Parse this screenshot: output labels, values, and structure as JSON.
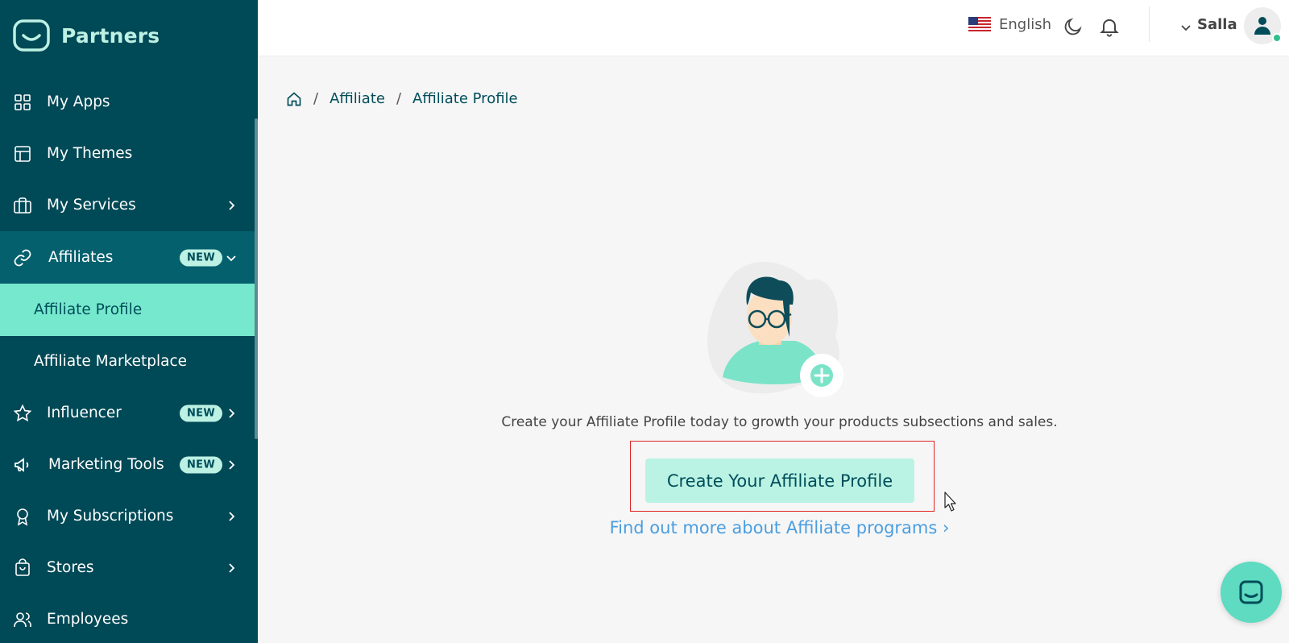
{
  "brand": {
    "name": "Partners"
  },
  "sidebar": {
    "items": [
      {
        "label": "My Apps",
        "icon": "grid-icon"
      },
      {
        "label": "My Themes",
        "icon": "layout-icon"
      },
      {
        "label": "My Services",
        "icon": "briefcase-icon",
        "has_chevron": true
      },
      {
        "label": "Affiliates",
        "icon": "link-icon",
        "badge": "NEW",
        "expanded": true
      },
      {
        "label": "Affiliate Profile",
        "sub": true,
        "selected": true
      },
      {
        "label": "Affiliate Marketplace",
        "sub": true
      },
      {
        "label": "Influencer",
        "icon": "star-icon",
        "badge": "NEW",
        "has_chevron": true
      },
      {
        "label": "Marketing Tools",
        "icon": "megaphone-icon",
        "badge": "NEW",
        "has_chevron": true
      },
      {
        "label": "My Subscriptions",
        "icon": "award-icon",
        "has_chevron": true
      },
      {
        "label": "Stores",
        "icon": "shopping-bag-icon",
        "has_chevron": true
      },
      {
        "label": "Employees",
        "icon": "users-icon"
      }
    ]
  },
  "header": {
    "language": "English",
    "user_name": "Salla"
  },
  "breadcrumb": {
    "items": [
      "Affiliate",
      "Affiliate Profile"
    ],
    "separator": "/"
  },
  "main": {
    "description": "Create your Affiliate Profile today to growth your products subsections and sales.",
    "cta_label": "Create Your Affiliate Profile",
    "learn_more": "Find out more about Affiliate programs ›"
  },
  "colors": {
    "sidebar_bg": "#004956",
    "accent": "#76e8cd",
    "cta_bg": "#baf3e4",
    "link": "#4a9ee0",
    "highlight_border": "#e02424"
  }
}
